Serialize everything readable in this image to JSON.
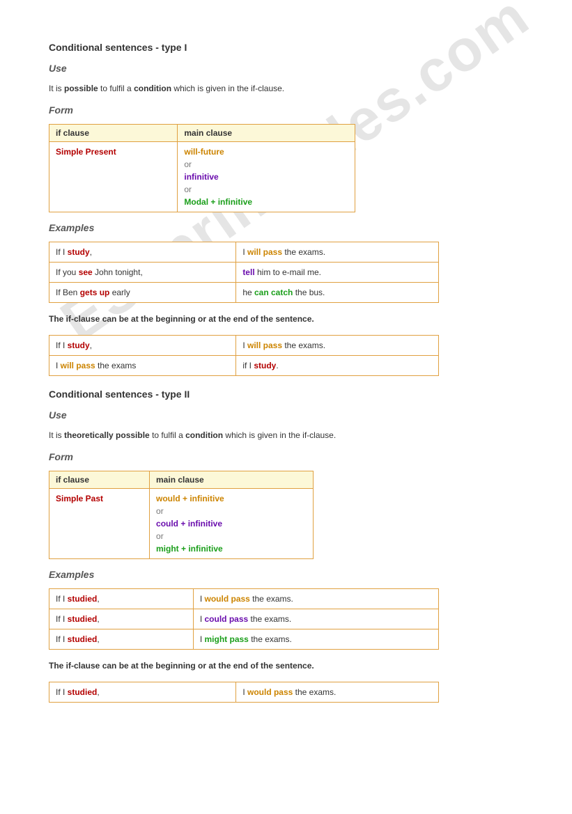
{
  "watermark": "ESLprintables.com",
  "type1": {
    "title": "Conditional sentences - type I",
    "use_heading": "Use",
    "use_text_1": "It is ",
    "use_bold_1": "possible",
    "use_text_2": " to fulfil a ",
    "use_bold_2": "condition",
    "use_text_3": " which is given in the if-clause.",
    "form_heading": "Form",
    "form_headers": {
      "if": "if clause",
      "main": "main clause"
    },
    "form_left": "Simple Present",
    "form_right": {
      "line1": "will-future",
      "or1": "or",
      "line2": "infinitive",
      "or2": "or",
      "line3": "Modal + infinitive"
    },
    "examples_heading": "Examples",
    "examples": [
      {
        "l1": "If I ",
        "l2": "study",
        "l3": ",",
        "r1": "I ",
        "r2": "will pass",
        "r3": " the exams.",
        "rclass": "orange"
      },
      {
        "l1": "If you ",
        "l2": "see",
        "l3": " John tonight,",
        "r1": "",
        "r2": "tell",
        "r3": " him to e-mail me.",
        "rclass": "purple"
      },
      {
        "l1": "If Ben ",
        "l2": "gets up",
        "l3": " early",
        "r1": "he ",
        "r2": "can catch",
        "r3": " the bus.",
        "rclass": "green"
      }
    ],
    "note": "The if-clause can be at the beginning or at the end of the sentence.",
    "note_table": [
      {
        "l1": "If I ",
        "l2": "study",
        "l3": ",",
        "r1": "I ",
        "r2": "will pass",
        "r3": " the exams.",
        "lclass": "red",
        "rclass": "orange"
      },
      {
        "l1": "I ",
        "l2": "will pass",
        "l3": " the exams",
        "r1": "if I ",
        "r2": "study",
        "r3": ".",
        "lclass": "orange",
        "rclass": "red"
      }
    ]
  },
  "type2": {
    "title": "Conditional sentences - type II",
    "use_heading": "Use",
    "use_text_1": "It is ",
    "use_bold_1": "theoretically possible",
    "use_text_2": " to fulfil a ",
    "use_bold_2": "condition",
    "use_text_3": " which is given in the if-clause.",
    "form_heading": "Form",
    "form_headers": {
      "if": "if clause",
      "main": "main clause"
    },
    "form_left": "Simple Past",
    "form_right": {
      "line1": "would + infinitive",
      "or1": "or",
      "line2": "could + infinitive",
      "or2": "or",
      "line3": "might + infinitive"
    },
    "examples_heading": "Examples",
    "examples": [
      {
        "l1": "If I ",
        "l2": "studied",
        "l3": ",",
        "r1": "I ",
        "r2": "would pass",
        "r3": " the exams.",
        "rclass": "orange"
      },
      {
        "l1": "If I ",
        "l2": "studied",
        "l3": ",",
        "r1": "I ",
        "r2": "could pass",
        "r3": " the exams.",
        "rclass": "purple"
      },
      {
        "l1": "If I ",
        "l2": "studied",
        "l3": ",",
        "r1": "I ",
        "r2": "might pass",
        "r3": " the exams.",
        "rclass": "green"
      }
    ],
    "note": "The if-clause can be at the beginning or at the end of the sentence.",
    "note_table": [
      {
        "l1": "If I ",
        "l2": "studied",
        "l3": ",",
        "r1": "I ",
        "r2": "would pass",
        "r3": " the exams.",
        "lclass": "red",
        "rclass": "orange"
      }
    ]
  }
}
